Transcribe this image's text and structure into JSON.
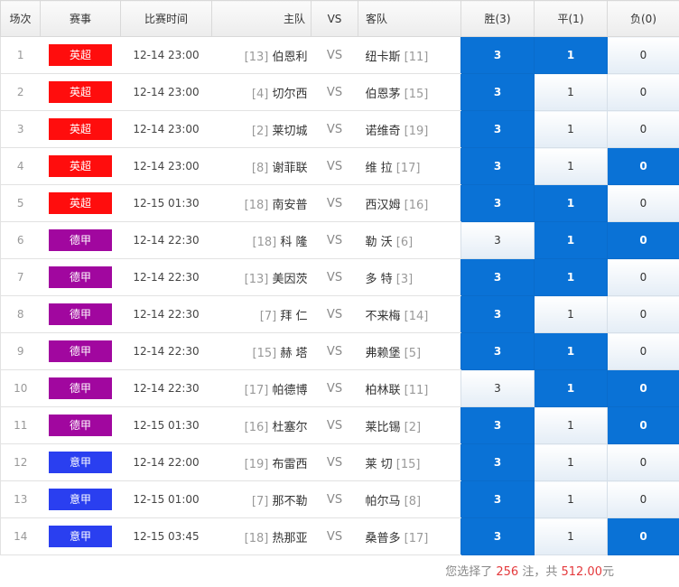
{
  "header": {
    "no": "场次",
    "league": "赛事",
    "time": "比赛时间",
    "home": "主队",
    "vs": "VS",
    "away": "客队",
    "win": "胜(3)",
    "draw": "平(1)",
    "lose": "负(0)"
  },
  "colors": {
    "英超": "#ff0d0d",
    "德甲": "#a1079f",
    "意甲": "#2a3ff0",
    "selected": "#0a72d6"
  },
  "matches": [
    {
      "no": "1",
      "league": "英超",
      "time": "12-14 23:00",
      "home_rank": "[13]",
      "home": "伯恩利",
      "vs": "VS",
      "away": "纽卡斯",
      "away_rank": "[11]",
      "win": "3",
      "draw": "1",
      "lose": "0",
      "win_sel": true,
      "draw_sel": true,
      "lose_sel": false
    },
    {
      "no": "2",
      "league": "英超",
      "time": "12-14 23:00",
      "home_rank": "[4]",
      "home": "切尔西",
      "vs": "VS",
      "away": "伯恩茅",
      "away_rank": "[15]",
      "win": "3",
      "draw": "1",
      "lose": "0",
      "win_sel": true,
      "draw_sel": false,
      "lose_sel": false
    },
    {
      "no": "3",
      "league": "英超",
      "time": "12-14 23:00",
      "home_rank": "[2]",
      "home": "莱切城",
      "vs": "VS",
      "away": "诺维奇",
      "away_rank": "[19]",
      "win": "3",
      "draw": "1",
      "lose": "0",
      "win_sel": true,
      "draw_sel": false,
      "lose_sel": false
    },
    {
      "no": "4",
      "league": "英超",
      "time": "12-14 23:00",
      "home_rank": "[8]",
      "home": "谢菲联",
      "vs": "VS",
      "away": "维 拉",
      "away_rank": "[17]",
      "win": "3",
      "draw": "1",
      "lose": "0",
      "win_sel": true,
      "draw_sel": false,
      "lose_sel": true
    },
    {
      "no": "5",
      "league": "英超",
      "time": "12-15 01:30",
      "home_rank": "[18]",
      "home": "南安普",
      "vs": "VS",
      "away": "西汉姆",
      "away_rank": "[16]",
      "win": "3",
      "draw": "1",
      "lose": "0",
      "win_sel": true,
      "draw_sel": true,
      "lose_sel": false
    },
    {
      "no": "6",
      "league": "德甲",
      "time": "12-14 22:30",
      "home_rank": "[18]",
      "home": "科 隆",
      "vs": "VS",
      "away": "勒 沃",
      "away_rank": "[6]",
      "win": "3",
      "draw": "1",
      "lose": "0",
      "win_sel": false,
      "draw_sel": true,
      "lose_sel": true
    },
    {
      "no": "7",
      "league": "德甲",
      "time": "12-14 22:30",
      "home_rank": "[13]",
      "home": "美因茨",
      "vs": "VS",
      "away": "多 特",
      "away_rank": "[3]",
      "win": "3",
      "draw": "1",
      "lose": "0",
      "win_sel": true,
      "draw_sel": true,
      "lose_sel": false
    },
    {
      "no": "8",
      "league": "德甲",
      "time": "12-14 22:30",
      "home_rank": "[7]",
      "home": "拜 仁",
      "vs": "VS",
      "away": "不来梅",
      "away_rank": "[14]",
      "win": "3",
      "draw": "1",
      "lose": "0",
      "win_sel": true,
      "draw_sel": false,
      "lose_sel": false
    },
    {
      "no": "9",
      "league": "德甲",
      "time": "12-14 22:30",
      "home_rank": "[15]",
      "home": "赫 塔",
      "vs": "VS",
      "away": "弗赖堡",
      "away_rank": "[5]",
      "win": "3",
      "draw": "1",
      "lose": "0",
      "win_sel": true,
      "draw_sel": true,
      "lose_sel": false
    },
    {
      "no": "10",
      "league": "德甲",
      "time": "12-14 22:30",
      "home_rank": "[17]",
      "home": "帕德博",
      "vs": "VS",
      "away": "柏林联",
      "away_rank": "[11]",
      "win": "3",
      "draw": "1",
      "lose": "0",
      "win_sel": false,
      "draw_sel": true,
      "lose_sel": true
    },
    {
      "no": "11",
      "league": "德甲",
      "time": "12-15 01:30",
      "home_rank": "[16]",
      "home": "杜塞尔",
      "vs": "VS",
      "away": "莱比锡",
      "away_rank": "[2]",
      "win": "3",
      "draw": "1",
      "lose": "0",
      "win_sel": true,
      "draw_sel": false,
      "lose_sel": true
    },
    {
      "no": "12",
      "league": "意甲",
      "time": "12-14 22:00",
      "home_rank": "[19]",
      "home": "布雷西",
      "vs": "VS",
      "away": "莱 切",
      "away_rank": "[15]",
      "win": "3",
      "draw": "1",
      "lose": "0",
      "win_sel": true,
      "draw_sel": false,
      "lose_sel": false
    },
    {
      "no": "13",
      "league": "意甲",
      "time": "12-15 01:00",
      "home_rank": "[7]",
      "home": "那不勒",
      "vs": "VS",
      "away": "帕尔马",
      "away_rank": "[8]",
      "win": "3",
      "draw": "1",
      "lose": "0",
      "win_sel": true,
      "draw_sel": false,
      "lose_sel": false
    },
    {
      "no": "14",
      "league": "意甲",
      "time": "12-15 03:45",
      "home_rank": "[18]",
      "home": "热那亚",
      "vs": "VS",
      "away": "桑普多",
      "away_rank": "[17]",
      "win": "3",
      "draw": "1",
      "lose": "0",
      "win_sel": true,
      "draw_sel": false,
      "lose_sel": true
    }
  ],
  "footer": {
    "prefix": "您选择了",
    "bets": "256",
    "mid": "注，共",
    "amount": "512.00",
    "suffix": "元"
  }
}
